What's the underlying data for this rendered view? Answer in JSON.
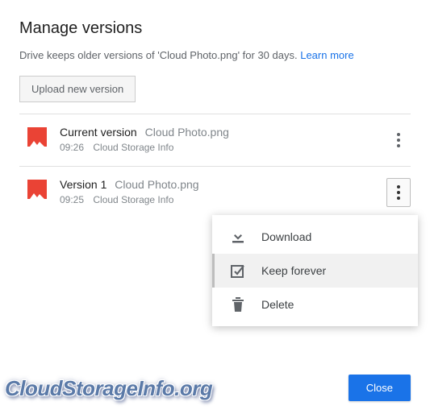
{
  "title": "Manage versions",
  "description_prefix": "Drive keeps older versions of 'Cloud Photo.png' for 30 days. ",
  "learn_more": "Learn more",
  "upload_button": "Upload new version",
  "versions": [
    {
      "name": "Current version",
      "file": "Cloud Photo.png",
      "time": "09:26",
      "author": "Cloud Storage Info"
    },
    {
      "name": "Version 1",
      "file": "Cloud Photo.png",
      "time": "09:25",
      "author": "Cloud Storage Info"
    }
  ],
  "menu": {
    "download": "Download",
    "keep_forever": "Keep forever",
    "delete": "Delete"
  },
  "close": "Close",
  "watermark": "CloudStorageInfo.org"
}
